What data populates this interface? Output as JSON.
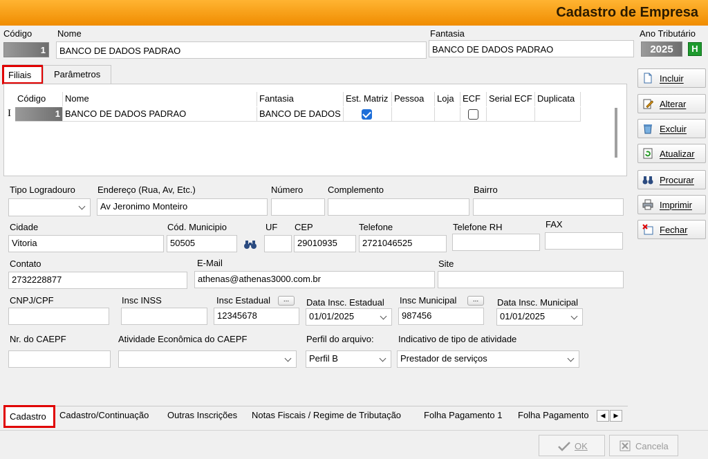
{
  "window": {
    "title": "Cadastro de Empresa"
  },
  "header": {
    "codigo_label": "Código",
    "codigo_value": "1",
    "nome_label": "Nome",
    "nome_value": "BANCO DE DADOS PADRAO",
    "fantasia_label": "Fantasia",
    "fantasia_value": "BANCO DE DADOS PADRAO",
    "ano_label": "Ano Tributário",
    "ano_value": "2025",
    "ano_button": "H"
  },
  "top_tabs": [
    "Filiais",
    "Parâmetros"
  ],
  "grid": {
    "headers": [
      "Código",
      "Nome",
      "Fantasia",
      "Est. Matriz",
      "Pessoa",
      "Loja",
      "ECF",
      "Serial ECF",
      "Duplicata"
    ],
    "row": {
      "codigo": "1",
      "nome": "BANCO DE DADOS PADRAO",
      "fantasia": "BANCO DE DADOS PADRAO",
      "est_matriz": true,
      "ecf": false
    },
    "row_indicator": "I"
  },
  "form": {
    "tipo_logradouro": {
      "label": "Tipo Logradouro",
      "value": ""
    },
    "endereco": {
      "label": "Endereço (Rua, Av,  Etc.)",
      "value": "Av Jeronimo Monteiro"
    },
    "numero": {
      "label": "Número",
      "value": ""
    },
    "complemento": {
      "label": "Complemento",
      "value": ""
    },
    "bairro": {
      "label": "Bairro",
      "value": ""
    },
    "cidade": {
      "label": "Cidade",
      "value": "Vitoria"
    },
    "cod_municipio": {
      "label": "Cód. Municipio",
      "value": "50505"
    },
    "uf": {
      "label": "UF",
      "value": ""
    },
    "cep": {
      "label": "CEP",
      "value": "29010935"
    },
    "telefone": {
      "label": "Telefone",
      "value": "2721046525"
    },
    "telefone_rh": {
      "label": "Telefone RH",
      "value": ""
    },
    "fax": {
      "label": "FAX",
      "value": ""
    },
    "contato": {
      "label": "Contato",
      "value": "2732228877"
    },
    "email": {
      "label": "E-Mail",
      "value": "athenas@athenas3000.com.br"
    },
    "site": {
      "label": "Site",
      "value": ""
    },
    "cnpj": {
      "label": "CNPJ/CPF",
      "value": ""
    },
    "insc_inss": {
      "label": "Insc INSS",
      "value": ""
    },
    "insc_estadual": {
      "label": "Insc Estadual",
      "value": "12345678",
      "btn": "..."
    },
    "data_insc_estadual": {
      "label": "Data Insc. Estadual",
      "value": "01/01/2025"
    },
    "insc_municipal": {
      "label": "Insc Municipal",
      "value": "987456",
      "btn": "..."
    },
    "data_insc_municipal": {
      "label": "Data Insc. Municipal",
      "value": "01/01/2025"
    },
    "caepf": {
      "label": "Nr. do CAEPF",
      "value": ""
    },
    "atividade_caepf": {
      "label": "Atividade Econômica do CAEPF",
      "value": ""
    },
    "perfil": {
      "label": "Perfil do arquivo:",
      "value": "Perfil B"
    },
    "indicativo": {
      "label": "Indicativo de tipo de atividade",
      "value": "Prestador de serviços"
    }
  },
  "bottom_tabs": [
    "Cadastro",
    "Cadastro/Continuação",
    "Outras Inscrições",
    "Notas Fiscais / Regime de Tributação",
    "Folha Pagamento 1",
    "Folha Pagamento"
  ],
  "side_buttons": [
    "Incluir",
    "Alterar",
    "Excluir",
    "Atualizar",
    "Procurar",
    "Imprimir",
    "Fechar"
  ],
  "footer": {
    "ok": "OK",
    "cancel": "Cancela"
  },
  "colors": {
    "title_bar": "#f5a623",
    "highlight": "#e00000",
    "check": "#1e6fd9"
  }
}
